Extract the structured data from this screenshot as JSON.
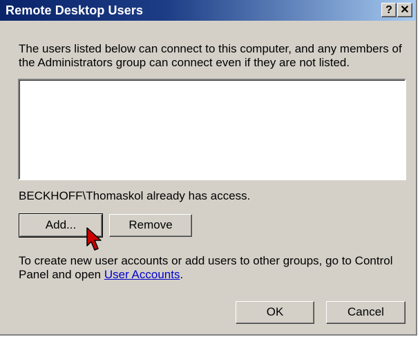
{
  "window": {
    "title": "Remote Desktop Users",
    "help_button": "?",
    "close_button": "✕"
  },
  "description": "The users listed below can connect to this computer, and any members of the Administrators group can connect even if they are not listed.",
  "users_list": [],
  "access_status": "BECKHOFF\\Thomaskol already has access.",
  "buttons": {
    "add": "Add...",
    "remove": "Remove",
    "ok": "OK",
    "cancel": "Cancel"
  },
  "help_text": {
    "prefix": "To create new user accounts or add users to other groups, go to Control Panel and open ",
    "link": "User Accounts",
    "suffix": "."
  },
  "colors": {
    "title_gradient_start": "#0a246a",
    "title_gradient_end": "#a6caf0",
    "dialog_background": "#d4d0c8",
    "cursor": "#cc0000"
  }
}
